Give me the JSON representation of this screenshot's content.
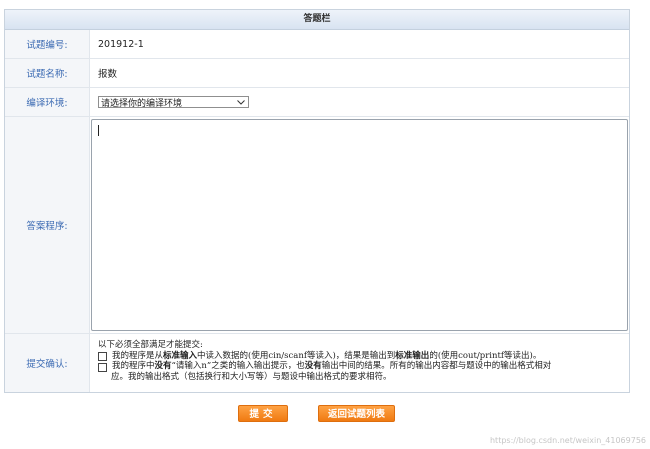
{
  "header": {
    "title": "答题栏"
  },
  "fields": {
    "id_label": "试题编号:",
    "id_value": "201912-1",
    "name_label": "试题名称:",
    "name_value": "报数",
    "compiler_label": "编译环境:",
    "compiler_selected": "请选择你的编译环境",
    "answer_label": "答案程序:",
    "confirm_label": "提交确认:"
  },
  "confirm": {
    "intro": "以下必须全部满足才能提交:",
    "item1": {
      "p1": "我的程序是从",
      "b1": "标准输入",
      "p2": "中读入数据的(使用cin/scanf等读入)，结果是输出到",
      "b2": "标准输出",
      "p3": "的(使用cout/printf等读出)。"
    },
    "item2": {
      "p1": "我的程序中",
      "b1": "没有",
      "p2": "“请输入n”之类的输入输出提示，也",
      "b2": "没有",
      "p3": "输出中间的结果。所有的输出内容都与题设中的输出格式相对",
      "cont": "应。我的输出格式（包括换行和大小写等）与题设中输出格式的要求相符。"
    }
  },
  "buttons": {
    "submit": "提交",
    "back": "返回试题列表"
  },
  "watermark": "https://blog.csdn.net/weixin_41069756",
  "colors": {
    "accent": "#f07a12",
    "label": "#3c6bb3",
    "header_bg": "#d8e3f1"
  }
}
